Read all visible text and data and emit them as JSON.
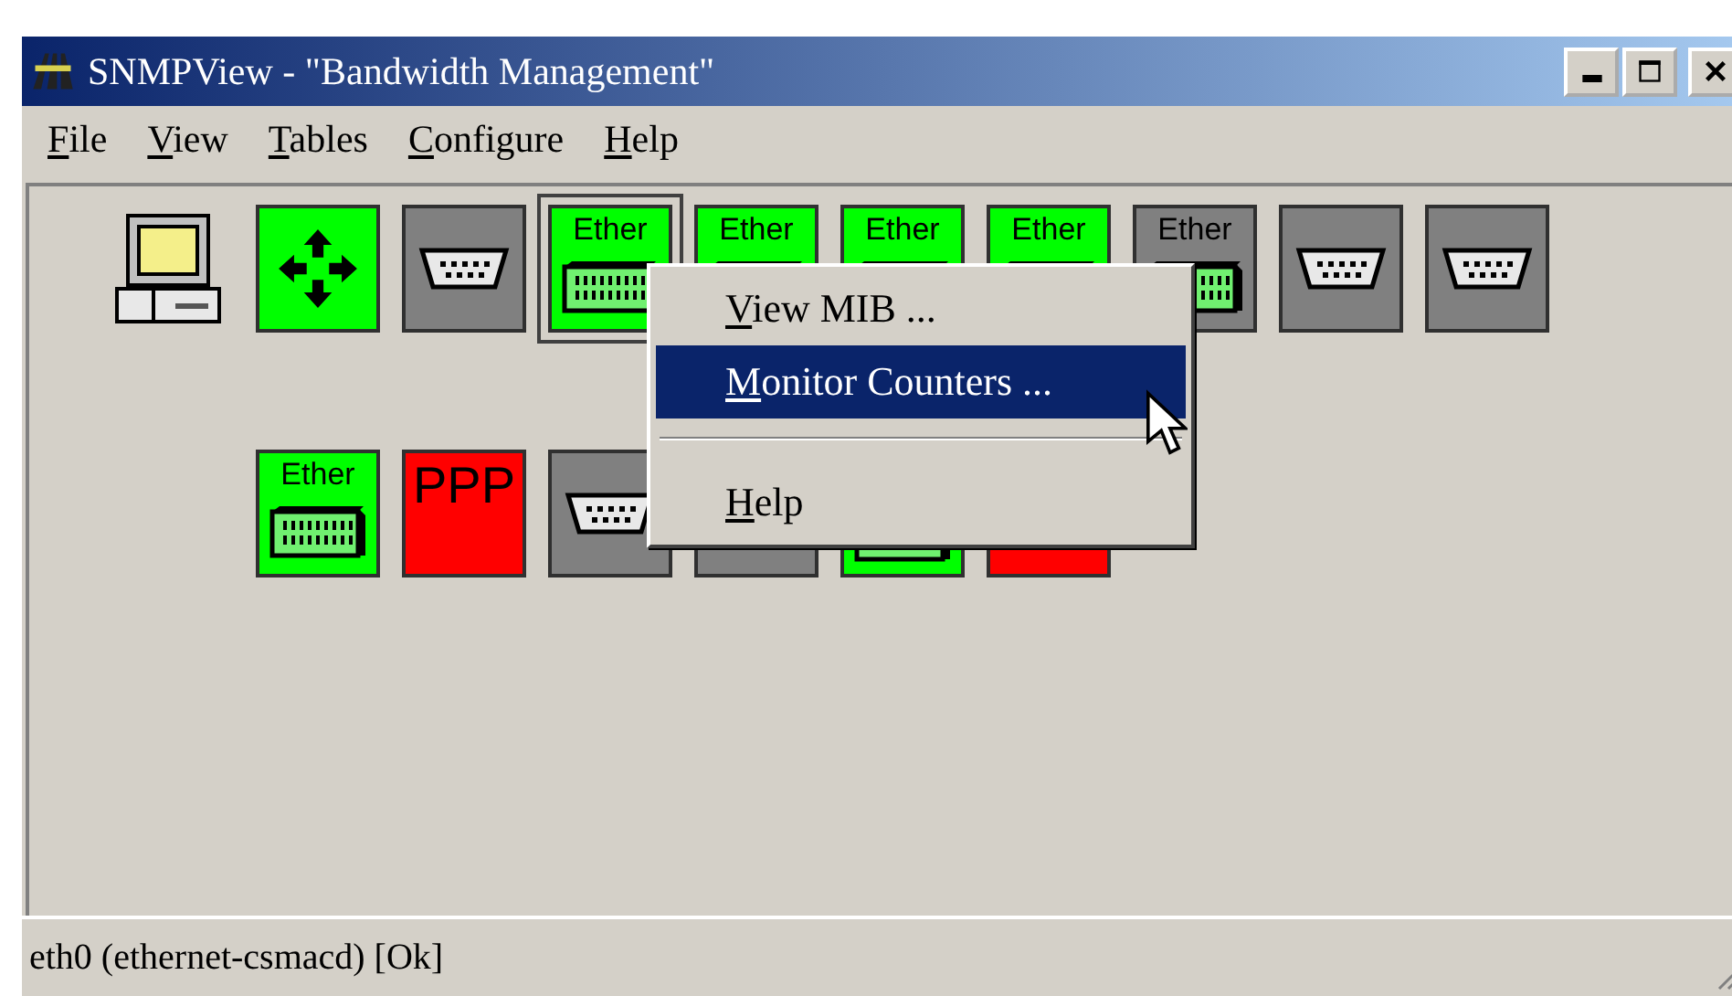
{
  "window": {
    "title": "SNMPView - \"Bandwidth Management\""
  },
  "menu_bar": [
    {
      "label": "File"
    },
    {
      "label": "View"
    },
    {
      "label": "Tables"
    },
    {
      "label": "Configure"
    },
    {
      "label": "Help"
    }
  ],
  "device_rows": [
    {
      "tiles": [
        {
          "kind": "router",
          "color": "#00ff00",
          "selected": false
        },
        {
          "kind": "serial",
          "color": "#808080",
          "selected": false
        },
        {
          "kind": "ether",
          "label": "Ether",
          "color": "#00ff00",
          "selected": true
        },
        {
          "kind": "ether",
          "label": "Ether",
          "color": "#00ff00",
          "selected": false
        },
        {
          "kind": "ether",
          "label": "Ether",
          "color": "#00ff00",
          "selected": false
        },
        {
          "kind": "ether",
          "label": "Ether",
          "color": "#00ff00",
          "selected": false
        },
        {
          "kind": "ether",
          "label": "Ether",
          "color": "#808080",
          "selected": false
        },
        {
          "kind": "serial",
          "color": "#808080",
          "selected": false
        },
        {
          "kind": "serial",
          "color": "#808080",
          "selected": false
        }
      ]
    },
    {
      "tiles": [
        {
          "kind": "ether",
          "label": "Ether",
          "color": "#00ff00",
          "selected": false
        },
        {
          "kind": "ppp",
          "label": "PPP",
          "color": "#ff0000",
          "selected": false
        },
        {
          "kind": "serial",
          "color": "#808080",
          "selected": false
        },
        {
          "kind": "plain",
          "color": "#808080",
          "selected": false
        },
        {
          "kind": "ether",
          "color": "#00ff00",
          "selected": false
        },
        {
          "kind": "ppp",
          "color": "#ff0000",
          "selected": false
        }
      ]
    }
  ],
  "context_menu": [
    {
      "kind": "item",
      "label": "View MIB ...",
      "selected": false
    },
    {
      "kind": "item",
      "label": "Monitor Counters ...",
      "selected": true
    },
    {
      "kind": "separator"
    },
    {
      "kind": "item",
      "label": "Help",
      "selected": false
    }
  ],
  "status_bar": {
    "text": "eth0 (ethernet-csmacd) [Ok]"
  }
}
